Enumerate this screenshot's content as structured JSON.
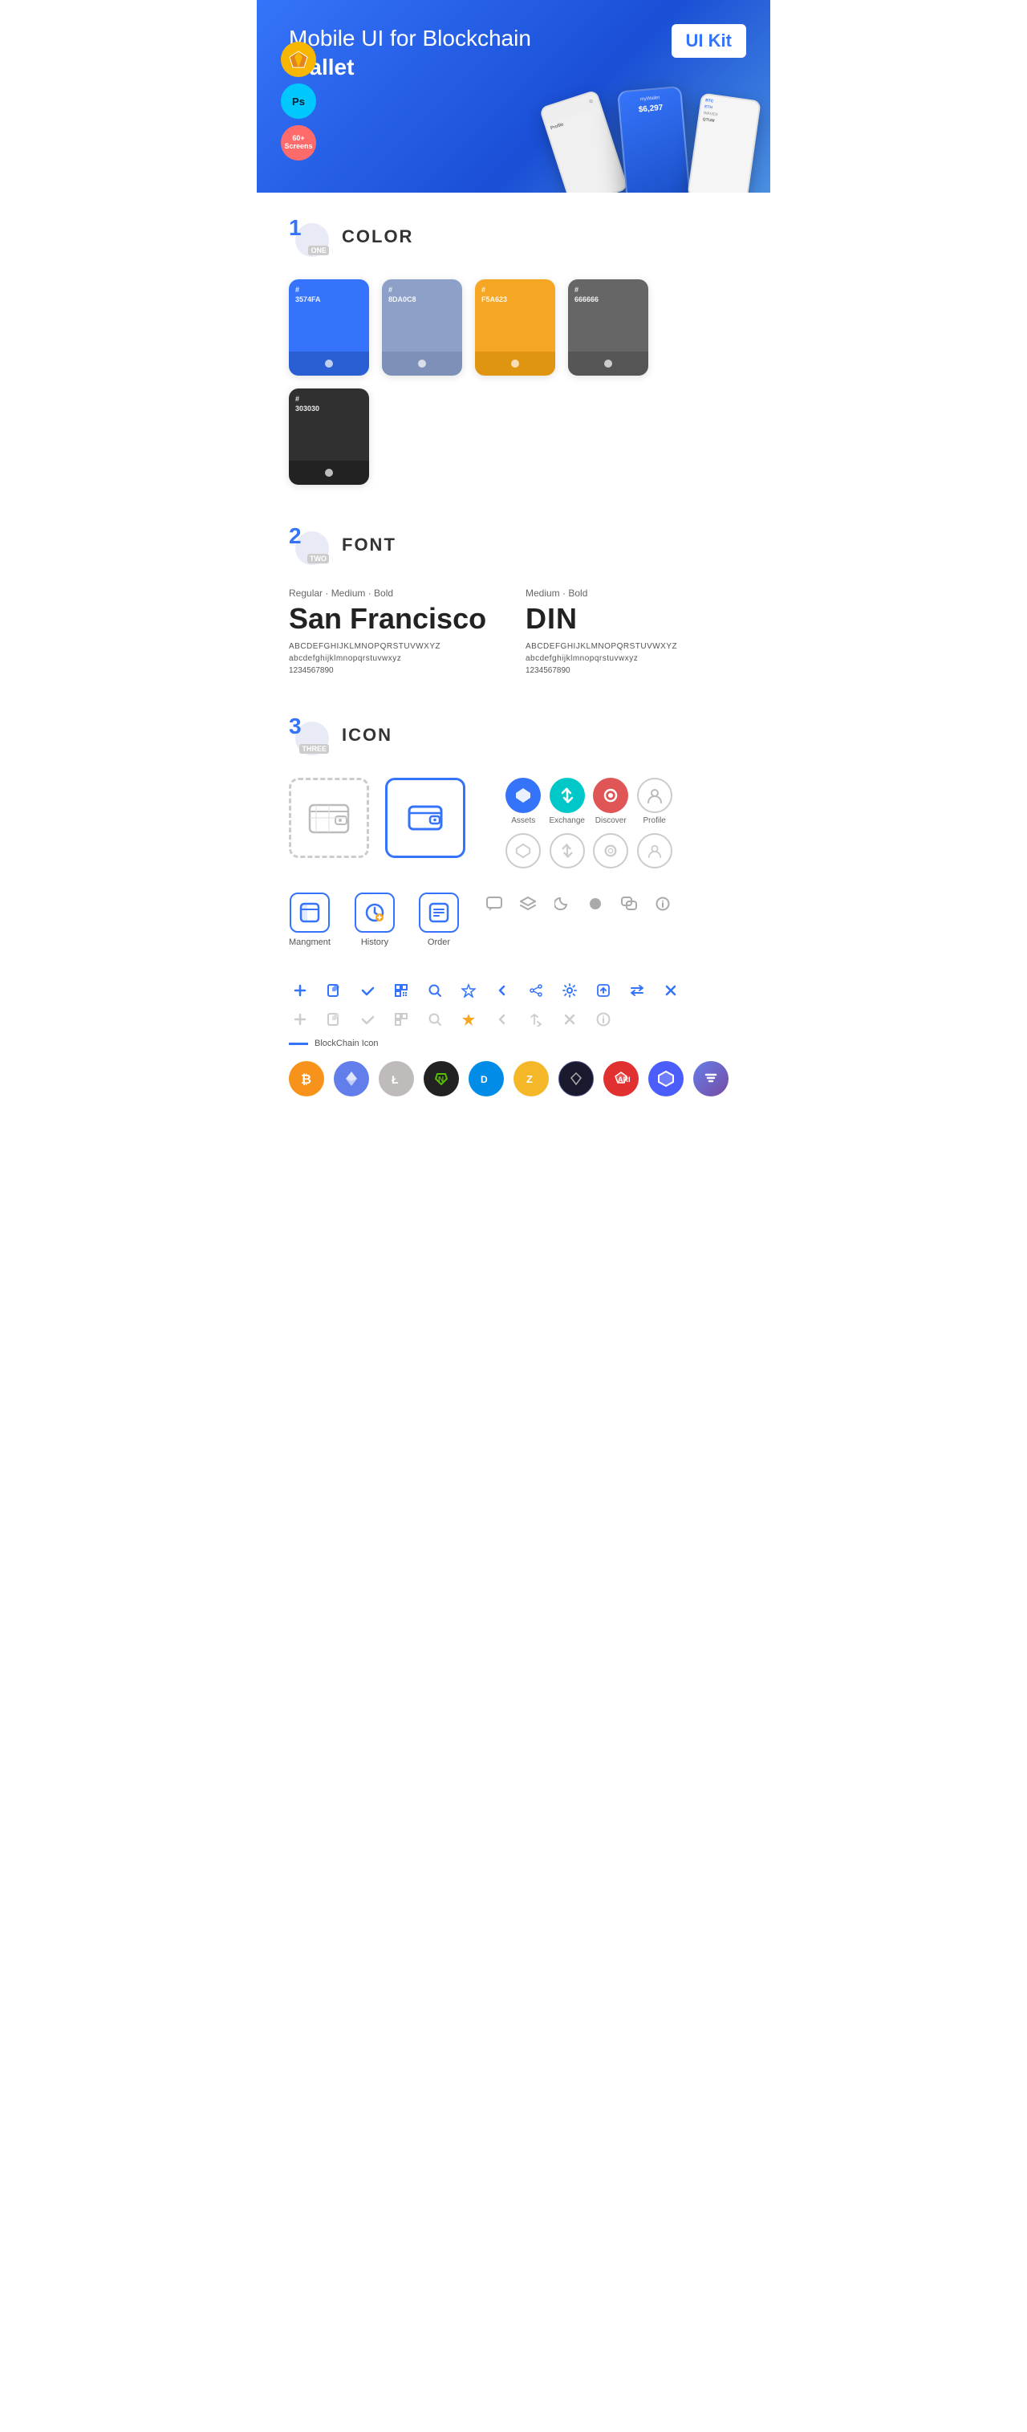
{
  "hero": {
    "title_part1": "Mobile UI for Blockchain ",
    "title_bold": "Wallet",
    "kit_badge": "UI Kit",
    "sketch_label": "Sketch",
    "ps_label": "PS",
    "screens_label": "60+\nScreens"
  },
  "section1": {
    "number": "1",
    "sub": "ONE",
    "title": "COLOR",
    "colors": [
      {
        "hex": "#3574FA",
        "code": "#\n3574FA"
      },
      {
        "hex": "#8DA0C8",
        "code": "#\n8DA0C8"
      },
      {
        "hex": "#F5A623",
        "code": "#\nF5A623"
      },
      {
        "hex": "#666666",
        "code": "#\n666666"
      },
      {
        "hex": "#303030",
        "code": "#\n303030"
      }
    ]
  },
  "section2": {
    "number": "2",
    "sub": "TWO",
    "title": "FONT",
    "fonts": [
      {
        "style": "Regular · Medium · Bold",
        "name": "San Francisco",
        "upper": "ABCDEFGHIJKLMNOPQRSTUVWXYZ",
        "lower": "abcdefghijklmnopqrstuvwxyz",
        "nums": "1234567890"
      },
      {
        "style": "Medium · Bold",
        "name": "DIN",
        "upper": "ABCDEFGHIJKLMNOPQRSTUVWXYZ",
        "lower": "abcdefghijklmnopqrstuvwxyz",
        "nums": "1234567890"
      }
    ]
  },
  "section3": {
    "number": "3",
    "sub": "THREE",
    "title": "ICON",
    "nav_icons": [
      {
        "label": "Assets",
        "color": "blue"
      },
      {
        "label": "Exchange",
        "color": "teal"
      },
      {
        "label": "Discover",
        "color": "red"
      },
      {
        "label": "Profile",
        "color": "outline"
      }
    ],
    "app_icons": [
      {
        "label": "Mangment"
      },
      {
        "label": "History"
      },
      {
        "label": "Order"
      }
    ],
    "blockchain_label": "BlockChain Icon",
    "coins": [
      {
        "label": "₿",
        "class": "coin-btc",
        "name": "Bitcoin"
      },
      {
        "label": "Ξ",
        "class": "coin-eth",
        "name": "Ethereum"
      },
      {
        "label": "Ł",
        "class": "coin-ltc",
        "name": "Litecoin"
      },
      {
        "label": "N",
        "class": "coin-neo",
        "name": "NEO"
      },
      {
        "label": "D",
        "class": "coin-dash",
        "name": "Dash"
      },
      {
        "label": "Z",
        "class": "coin-zcash",
        "name": "Zcash"
      },
      {
        "label": "⬡",
        "class": "coin-iota",
        "name": "IOTA"
      },
      {
        "label": "A",
        "class": "coin-ark",
        "name": "ARK"
      },
      {
        "label": "P",
        "class": "coin-poly",
        "name": "Polymath"
      },
      {
        "label": "S",
        "class": "coin-stratis",
        "name": "Stratis"
      }
    ]
  }
}
